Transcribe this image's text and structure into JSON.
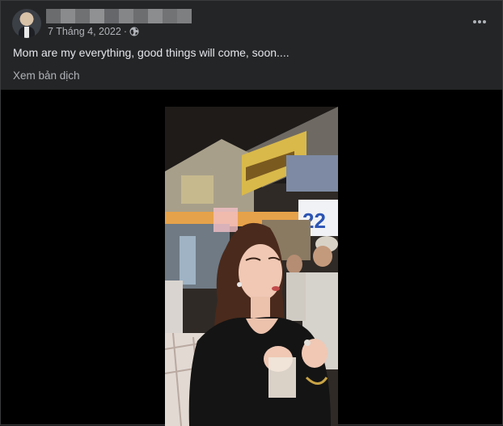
{
  "post": {
    "author_name": "",
    "date": "7 Tháng 4, 2022",
    "separator": "·",
    "caption": "Mom are my everything, good things will come, soon....",
    "translate_label": "Xem bản dịch",
    "more_icon": "more-horizontal-icon",
    "privacy_icon": "globe-icon"
  },
  "colors": {
    "card_bg": "#242526",
    "text_primary": "#e4e6eb",
    "text_secondary": "#b0b3b8",
    "media_bg": "#000000"
  }
}
